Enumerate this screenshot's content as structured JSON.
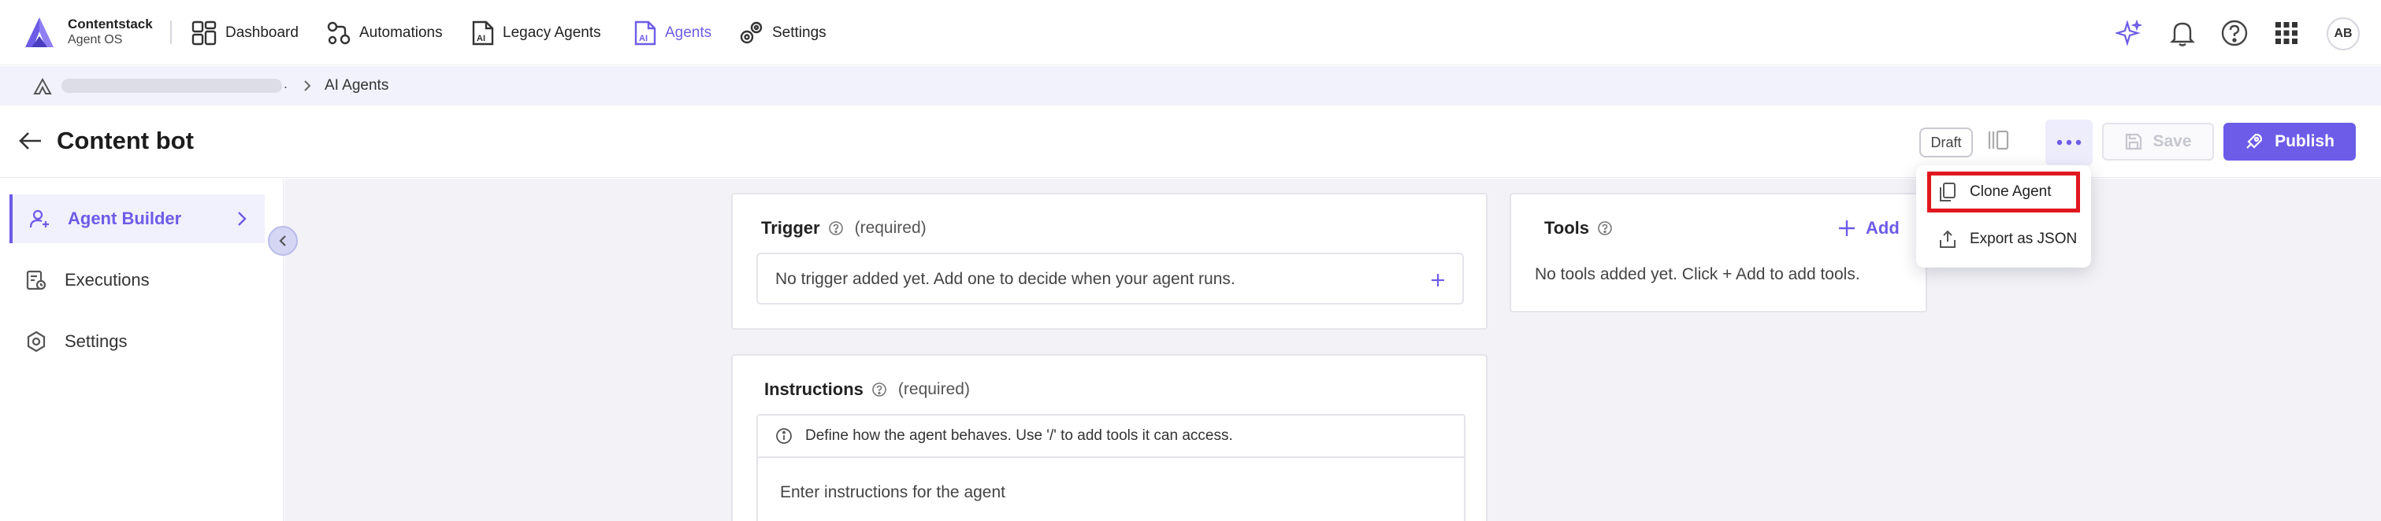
{
  "app": {
    "brand_name": "Contentstack",
    "brand_sub": "Agent OS"
  },
  "nav": {
    "items": [
      {
        "label": "Dashboard",
        "icon": "dashboard-icon",
        "active": false
      },
      {
        "label": "Automations",
        "icon": "automations-icon",
        "active": false
      },
      {
        "label": "Legacy Agents",
        "icon": "legacy-agents-icon",
        "active": false
      },
      {
        "label": "Agents",
        "icon": "agents-icon",
        "active": true
      },
      {
        "label": "Settings",
        "icon": "settings-gears-icon",
        "active": false
      }
    ],
    "right_icons": [
      "sparkle-icon",
      "bell-icon",
      "help-icon",
      "apps-grid-icon"
    ],
    "avatar_initials": "AB"
  },
  "breadcrumb": {
    "dot": ".",
    "current": "AI Agents"
  },
  "header": {
    "title": "Content bot",
    "status": "Draft",
    "save_label": "Save",
    "publish_label": "Publish"
  },
  "menu": {
    "items": [
      {
        "label": "Clone Agent",
        "icon": "copy-icon",
        "highlighted": true
      },
      {
        "label": "Export as JSON",
        "icon": "export-icon",
        "highlighted": false
      }
    ]
  },
  "sidebar": {
    "items": [
      {
        "label": "Agent Builder",
        "icon": "agent-builder-icon",
        "active": true
      },
      {
        "label": "Executions",
        "icon": "executions-icon",
        "active": false
      },
      {
        "label": "Settings",
        "icon": "settings-icon",
        "active": false
      }
    ]
  },
  "trigger": {
    "title": "Trigger",
    "required": "(required)",
    "empty": "No trigger added yet. Add one to decide when your agent runs."
  },
  "tools": {
    "title": "Tools",
    "add_label": "Add",
    "empty": "No tools added yet. Click + Add to add tools."
  },
  "instructions": {
    "title": "Instructions",
    "required": "(required)",
    "hint": "Define how the agent behaves. Use '/' to add tools it can access.",
    "placeholder": "Enter instructions for the agent"
  },
  "colors": {
    "accent": "#6c5ce7",
    "highlight_border": "#e0171f",
    "canvas_bg": "#f3f3f7"
  }
}
